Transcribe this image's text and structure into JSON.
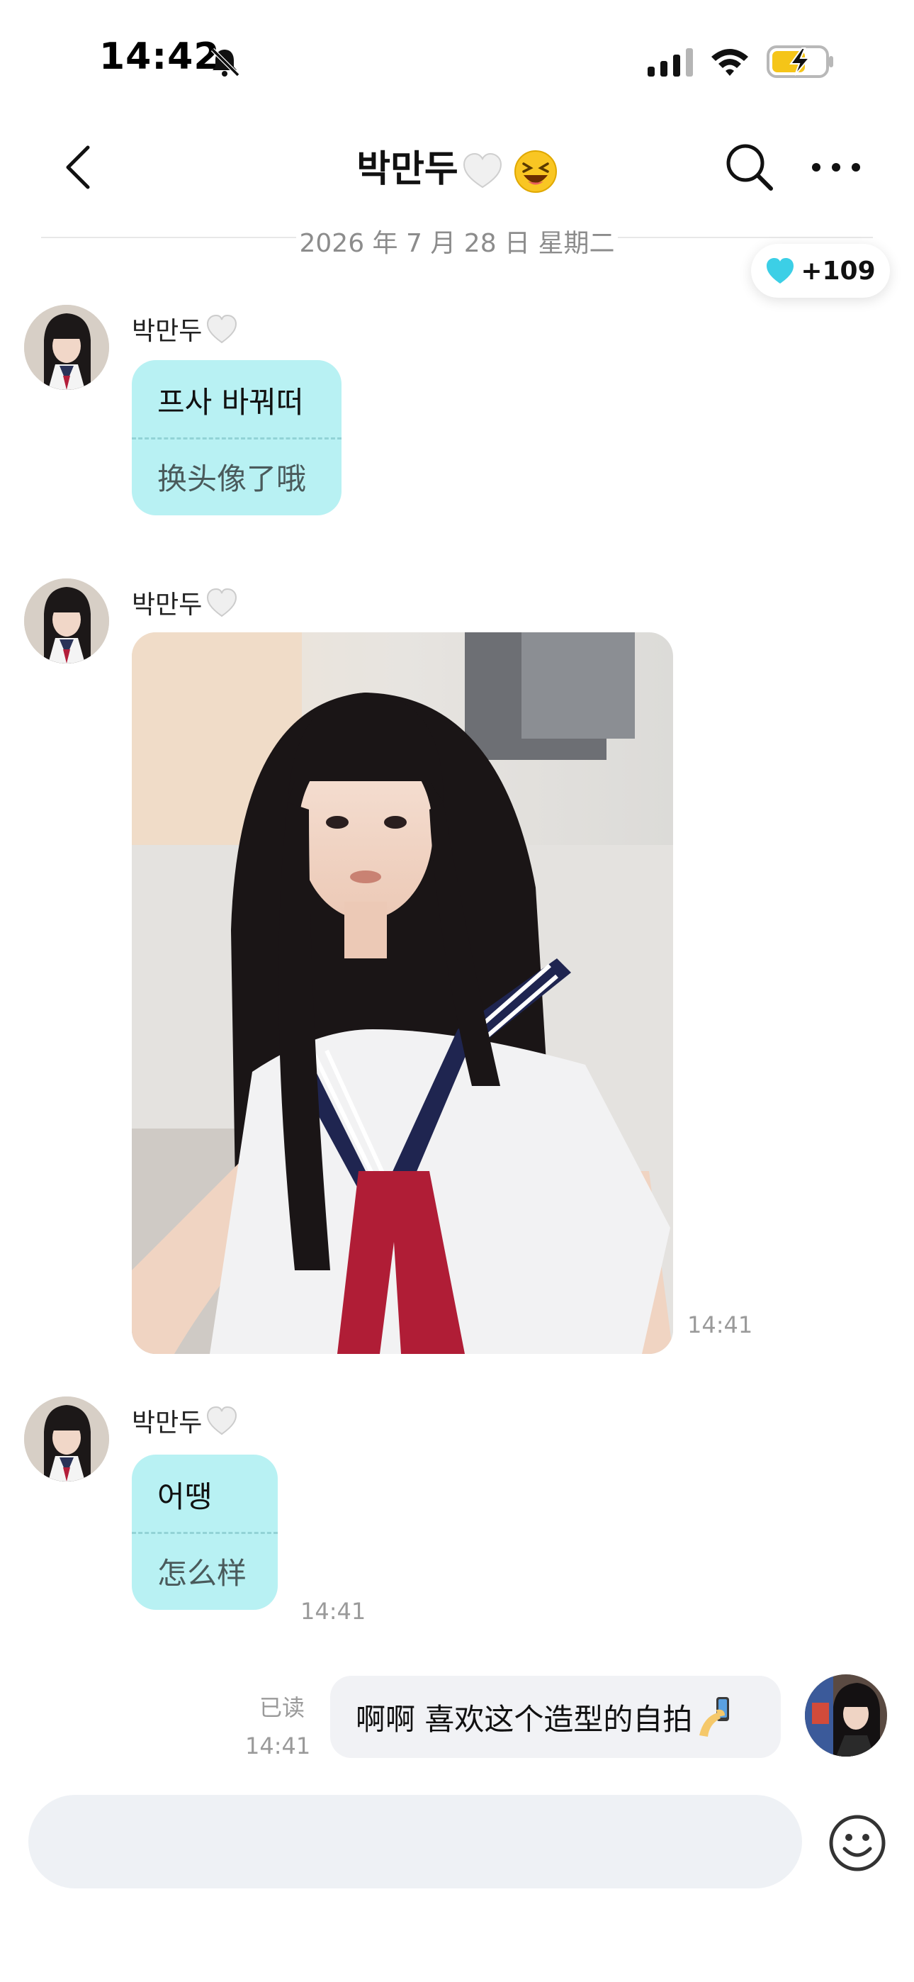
{
  "status_bar": {
    "time": "14:42",
    "icons": [
      "bell-muted-icon",
      "cellular-signal-icon",
      "wifi-icon",
      "battery-charging-icon"
    ]
  },
  "header": {
    "title": "박만두",
    "icons": [
      "back-chevron-icon",
      "search-icon",
      "more-icon"
    ]
  },
  "date_separator": "2026 年 7 月 28 日  星期二",
  "hearts": {
    "count": "+109",
    "color": "#3ccfe6"
  },
  "messages": [
    {
      "sender": "박만두",
      "original": "프사 바꿔떠",
      "translation": "换头像了哦"
    },
    {
      "sender": "박만두",
      "type": "image",
      "time": "14:41"
    },
    {
      "sender": "박만두",
      "original": "어땡",
      "translation": "怎么样",
      "time": "14:41"
    }
  ],
  "outgoing": {
    "read_status": "已读",
    "time": "14:41",
    "text": "啊啊 喜欢这个造型的自拍"
  },
  "input": {
    "placeholder": ""
  },
  "colors": {
    "incoming_bubble": "#b8f1f3",
    "outgoing_bubble": "#f1f2f5",
    "input_bg": "#eef1f5"
  }
}
